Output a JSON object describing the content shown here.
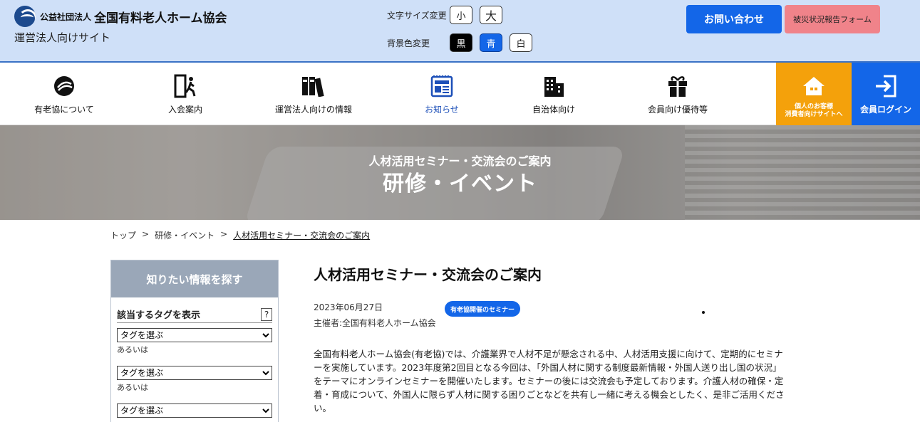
{
  "header": {
    "logo_small": "公益社団法人",
    "logo_name": "全国有料老人ホーム協会",
    "site_subtitle": "運営法人向けサイト",
    "font_size_label": "文字サイズ変更",
    "font_small": "小",
    "font_large": "大",
    "bg_color_label": "背景色変更",
    "bg_black": "黒",
    "bg_blue": "青",
    "bg_white": "白",
    "contact": "お問い合わせ",
    "disaster_form": "被災状況報告フォーム"
  },
  "nav": {
    "items": [
      {
        "label": "有老協について",
        "icon": "logo-emblem-icon"
      },
      {
        "label": "入会案内",
        "icon": "enter-door-icon"
      },
      {
        "label": "運営法人向けの情報",
        "icon": "binders-icon"
      },
      {
        "label": "お知らせ",
        "icon": "newspaper-icon"
      },
      {
        "label": "自治体向け",
        "icon": "building-icon"
      },
      {
        "label": "会員向け優待等",
        "icon": "gift-icon"
      }
    ],
    "personal_line1": "個人のお客様",
    "personal_line2": "消費者向けサイトへ",
    "login": "会員ログイン"
  },
  "hero": {
    "subtitle": "人材活用セミナー・交流会のご案内",
    "title": "研修・イベント"
  },
  "breadcrumb": {
    "top": "トップ",
    "sep": ">",
    "events": "研修・イベント",
    "current": "人材活用セミナー・交流会のご案内"
  },
  "sidebar": {
    "heading": "知りたい情報を探す",
    "tag_title": "該当するタグを表示",
    "help": "?",
    "select_placeholder": "タグを選ぶ",
    "or": "あるいは"
  },
  "article": {
    "title": "人材活用セミナー・交流会のご案内",
    "date": "2023年06月27日",
    "host": "主催者:全国有料老人ホーム協会",
    "badge": "有老協開催のセミナー",
    "body": "全国有料老人ホーム協会(有老協)では、介護業界で人材不足が懸念される中、人材活用支援に向けて、定期的にセミナーを実施しています。2023年度第2回目となる今回は、「外国人材に関する制度最新情報・外国人送り出し国の状況」をテーマにオンラインセミナーを開催いたします。セミナーの後には交流会も予定しております。介護人材の確保・定着・育成について、外国人に限らず人材に関する困りごとなどを共有し一緒に考える機会としたく、是非ご活用ください。"
  },
  "colors": {
    "primary_blue": "#1366e8",
    "header_bg": "#cfe0f8",
    "personal_orange": "#f4a10b",
    "disaster_pink": "#f0838a"
  }
}
